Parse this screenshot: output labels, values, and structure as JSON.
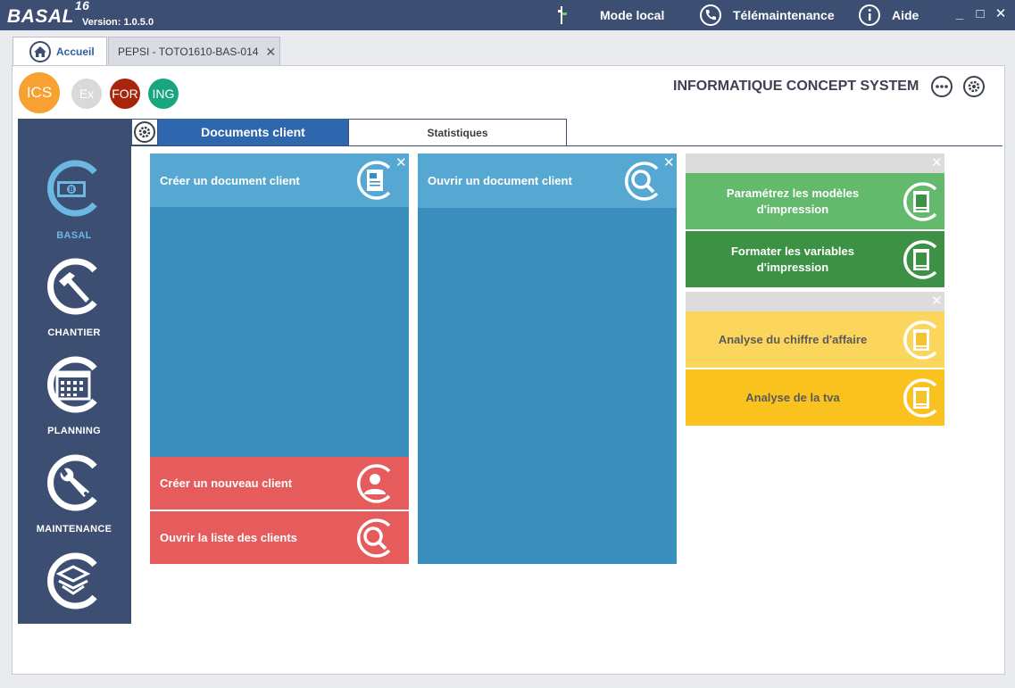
{
  "app": {
    "logo": "BASAL",
    "logo_sup": "16",
    "version": "Version: 1.0.5.0"
  },
  "titlebar": {
    "mode_local": "Mode local",
    "telemaintenance": "Télémaintenance",
    "aide": "Aide",
    "minimize": "_",
    "maximize": "□",
    "close": "✕"
  },
  "tabs": [
    {
      "label": "Accueil"
    },
    {
      "label": "PEPSI - TOTO1610-BAS-014"
    }
  ],
  "tab_close": "✕",
  "companies": [
    {
      "label": "ICS",
      "color": "#f7a130"
    },
    {
      "label": "Ex",
      "color": "#d9d9d9"
    },
    {
      "label": "FOR",
      "color": "#a8250c"
    },
    {
      "label": "ING",
      "color": "#17a680"
    }
  ],
  "company_name": "INFORMATIQUE CONCEPT SYSTEM",
  "sidebar": {
    "items": [
      {
        "label": "BASAL",
        "icon": "banknote-icon"
      },
      {
        "label": "CHANTIER",
        "icon": "hammer-icon"
      },
      {
        "label": "PLANNING",
        "icon": "calendar-icon"
      },
      {
        "label": "MAINTENANCE",
        "icon": "wrench-icon"
      },
      {
        "label": "",
        "icon": "box-icon"
      }
    ]
  },
  "subtabs": [
    {
      "label": "Documents client"
    },
    {
      "label": "Statistiques"
    }
  ],
  "tiles": {
    "create_doc": "Créer un document client",
    "open_doc": "Ouvrir un document client",
    "new_client": "Créer un nouveau client",
    "client_list": "Ouvrir la liste des clients",
    "param_models": "Paramétrez les modèles d'impression",
    "format_vars": "Formater les variables d'impression",
    "analyse_ca": "Analyse du chiffre d'affaire",
    "analyse_tva": "Analyse de la tva",
    "close": "✕"
  },
  "colors": {
    "titlebar": "#3d4e73",
    "blue_tile_header": "#56a8d3",
    "blue_tile_body": "#3a8ebd",
    "red_tile": "#e65b5b",
    "green_light": "#63ba6c",
    "green_dark": "#3c9145",
    "yellow_light": "#fcd55c",
    "yellow_dark": "#f9c21e",
    "tab_active": "#2f67ae"
  }
}
